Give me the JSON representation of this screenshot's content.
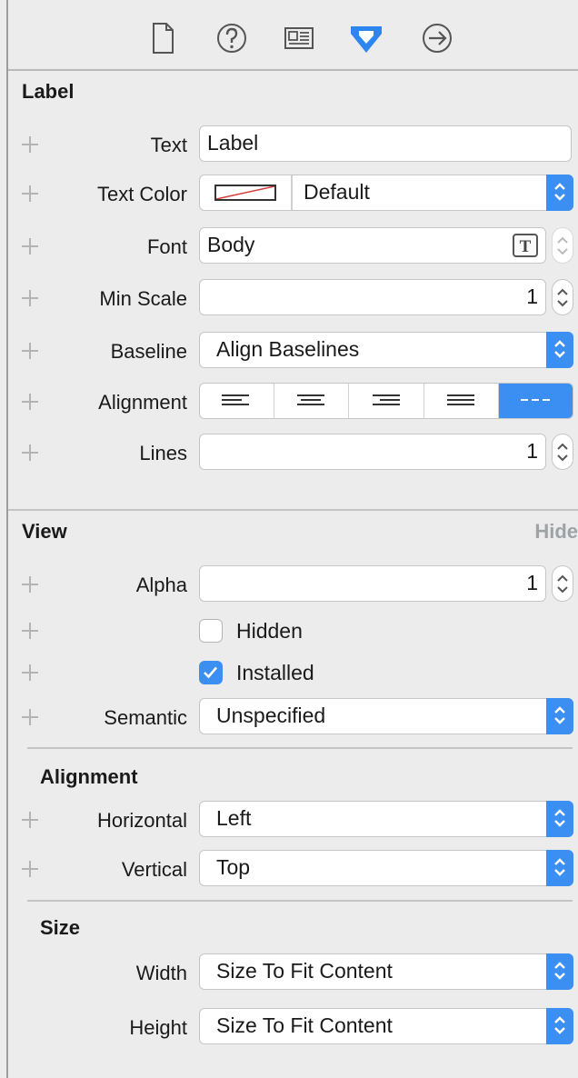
{
  "toolbar": {
    "icons": [
      "file-inspector-icon",
      "quick-help-icon",
      "identity-inspector-icon",
      "attributes-inspector-icon",
      "connections-inspector-icon"
    ],
    "accent": "#3b8ff3"
  },
  "label_section": {
    "title": "Label",
    "text_label": "Text",
    "text_value": "Label",
    "text_color_label": "Text Color",
    "text_color_value": "Default",
    "font_label": "Font",
    "font_value": "Body",
    "min_scale_label": "Min Scale",
    "min_scale_value": "1",
    "baseline_label": "Baseline",
    "baseline_value": "Align Baselines",
    "alignment_label": "Alignment",
    "alignment_options": [
      "left",
      "center",
      "right",
      "justified",
      "natural"
    ],
    "alignment_selected": "natural",
    "lines_label": "Lines",
    "lines_value": "1"
  },
  "view_section": {
    "title": "View",
    "hide_label": "Hide",
    "alpha_label": "Alpha",
    "alpha_value": "1",
    "hidden_label": "Hidden",
    "hidden_checked": false,
    "installed_label": "Installed",
    "installed_checked": true,
    "semantic_label": "Semantic",
    "semantic_value": "Unspecified"
  },
  "alignment_section": {
    "title": "Alignment",
    "horizontal_label": "Horizontal",
    "horizontal_value": "Left",
    "vertical_label": "Vertical",
    "vertical_value": "Top"
  },
  "size_section": {
    "title": "Size",
    "width_label": "Width",
    "width_value": "Size To Fit Content",
    "height_label": "Height",
    "height_value": "Size To Fit Content"
  }
}
